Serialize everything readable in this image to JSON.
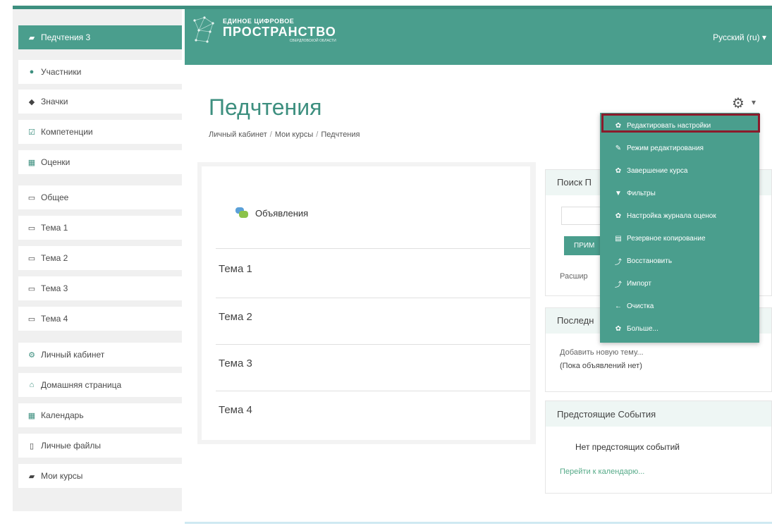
{
  "header": {
    "logo_small": "ЕДИНОЕ ЦИФРОВОЕ",
    "logo_big": "ПРОСТРАНСТВО",
    "logo_tiny": "СВЕРДЛОВСКОЙ ОБЛАСТИ",
    "language": "Русский (ru) ▾"
  },
  "sidebar": {
    "items": [
      {
        "label": "Педчтения 3",
        "icon": "graduation-cap-icon",
        "glyph": "🎓"
      },
      {
        "label": "Участники",
        "icon": "users-icon",
        "glyph": "👥"
      },
      {
        "label": "Значки",
        "icon": "shield-icon",
        "glyph": "🛡"
      },
      {
        "label": "Компетенции",
        "icon": "checkbox-icon",
        "glyph": "☑"
      },
      {
        "label": "Оценки",
        "icon": "table-icon",
        "glyph": "▦"
      },
      {
        "label": "Общее",
        "icon": "folder-icon",
        "glyph": "▭"
      },
      {
        "label": "Тема 1",
        "icon": "folder-icon",
        "glyph": "▭"
      },
      {
        "label": "Тема 2",
        "icon": "folder-icon",
        "glyph": "▭"
      },
      {
        "label": "Тема 3",
        "icon": "folder-icon",
        "glyph": "▭"
      },
      {
        "label": "Тема 4",
        "icon": "folder-icon",
        "glyph": "▭"
      },
      {
        "label": "Личный кабинет",
        "icon": "dashboard-icon",
        "glyph": "⚙"
      },
      {
        "label": "Домашняя страница",
        "icon": "home-icon",
        "glyph": "⌂"
      },
      {
        "label": "Календарь",
        "icon": "calendar-icon",
        "glyph": "▦"
      },
      {
        "label": "Личные файлы",
        "icon": "file-icon",
        "glyph": "▯"
      },
      {
        "label": "Мои курсы",
        "icon": "graduation-cap-icon",
        "glyph": "🎓"
      }
    ]
  },
  "page": {
    "title": "Педчтения",
    "breadcrumb": [
      "Личный кабинет",
      "Мои курсы",
      "Педчтения"
    ]
  },
  "course": {
    "forum": "Объявления",
    "topics": [
      "Тема 1",
      "Тема 2",
      "Тема 3",
      "Тема 4"
    ]
  },
  "blocks": {
    "search_title": "Поиск П",
    "search_button": "ПРИМ",
    "search_advanced": "Расшир",
    "news_title": "Последн",
    "news_add": "Добавить новую тему...",
    "news_empty": "(Пока объявлений нет)",
    "events_title": "Предстоящие События",
    "events_empty": "Нет предстоящих событий",
    "events_link": "Перейти к календарю..."
  },
  "menu": {
    "items": [
      {
        "label": "Редактировать настройки",
        "icon": "gear-icon",
        "glyph": "✿"
      },
      {
        "label": "Режим редактирования",
        "icon": "pencil-icon",
        "glyph": "✎"
      },
      {
        "label": "Завершение курса",
        "icon": "gear-icon",
        "glyph": "✿"
      },
      {
        "label": "Фильтры",
        "icon": "filter-icon",
        "glyph": "▼"
      },
      {
        "label": "Настройка журнала оценок",
        "icon": "gear-icon",
        "glyph": "✿"
      },
      {
        "label": "Резервное копирование",
        "icon": "file-icon",
        "glyph": "▤"
      },
      {
        "label": "Восстановить",
        "icon": "upload-icon",
        "glyph": "⤴"
      },
      {
        "label": "Импорт",
        "icon": "upload-icon",
        "glyph": "⤴"
      },
      {
        "label": "Очистка",
        "icon": "arrow-left-icon",
        "glyph": "←"
      },
      {
        "label": "Больше...",
        "icon": "gear-icon",
        "glyph": "✿"
      }
    ]
  },
  "colors": {
    "accent": "#4a9e8d",
    "highlight": "#8b1a2b"
  }
}
